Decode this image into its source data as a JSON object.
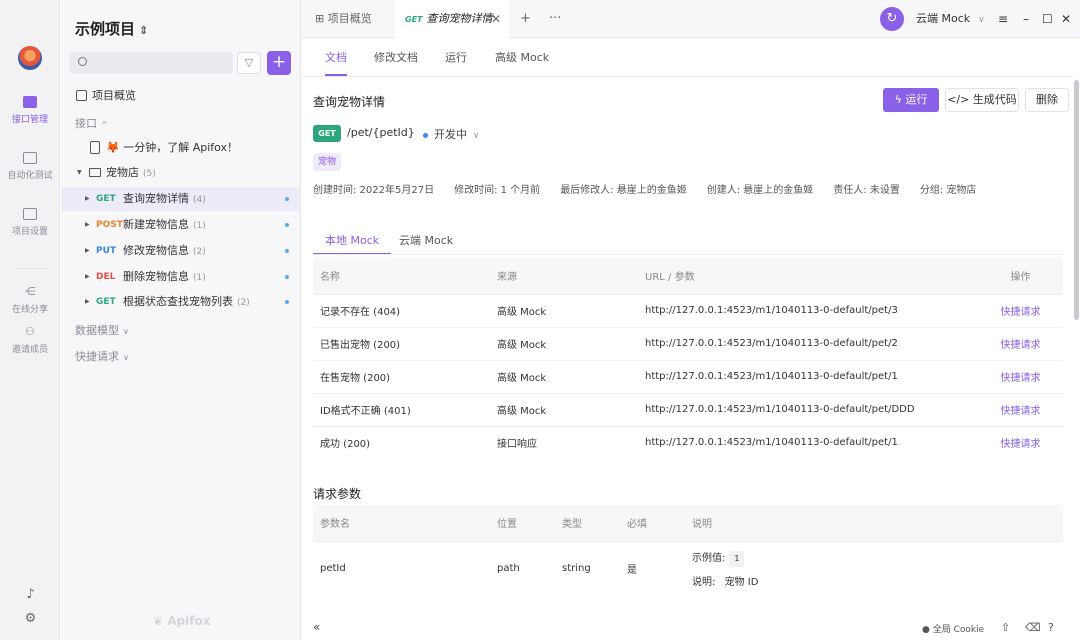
{
  "rail": {
    "items": [
      {
        "label": "接口管理"
      },
      {
        "label": "自动化测试"
      },
      {
        "label": "项目设置"
      },
      {
        "label": "在线分享"
      },
      {
        "label": "邀请成员"
      }
    ]
  },
  "sidebar": {
    "project_title": "示例项目",
    "overview": "项目概览",
    "api_section": "接口",
    "intro_item": "🦊 一分钟，了解 Apifox！",
    "folder": {
      "name": "宠物店",
      "count": "(5)"
    },
    "endpoints": [
      {
        "method": "GET",
        "name": "查询宠物详情",
        "count": "(4)"
      },
      {
        "method": "POST",
        "name": "新建宠物信息",
        "count": "(1)"
      },
      {
        "method": "PUT",
        "name": "修改宠物信息",
        "count": "(2)"
      },
      {
        "method": "DEL",
        "name": "删除宠物信息",
        "count": "(1)"
      },
      {
        "method": "GET",
        "name": "根据状态查找宠物列表",
        "count": "(2)"
      }
    ],
    "data_models": "数据模型",
    "quick_requests": "快捷请求",
    "brand": "Apifox"
  },
  "tabbar": {
    "tab_overview": "项目概览",
    "tab_active_method": "GET",
    "tab_active_label": "查询宠物详情",
    "env_label": "云端 Mock"
  },
  "content_tabs": [
    "文档",
    "修改文档",
    "运行",
    "高级 Mock"
  ],
  "doc": {
    "title": "查询宠物详情",
    "run_button": "运行",
    "gencode_button": "生成代码",
    "delete_button": "删除",
    "method": "GET",
    "path": "/pet/{petId}",
    "status": "开发中",
    "tag": "宠物",
    "meta": {
      "created": "创建时间: 2022年5月27日",
      "modified": "修改时间: 1 个月前",
      "last_editor": "最后修改人: 悬崖上的金鱼姬",
      "creator": "创建人: 悬崖上的金鱼姬",
      "owner": "责任人: 未设置",
      "group": "分组: 宠物店"
    }
  },
  "mock": {
    "tabs": [
      "本地 Mock",
      "云端 Mock"
    ],
    "headers": [
      "名称",
      "来源",
      "URL / 参数",
      "操作"
    ],
    "rows": [
      {
        "name": "记录不存在 (404)",
        "source": "高级 Mock",
        "url": "http://127.0.0.1:4523/m1/1040113-0-default/pet/3",
        "action": "快捷请求"
      },
      {
        "name": "已售出宠物 (200)",
        "source": "高级 Mock",
        "url": "http://127.0.0.1:4523/m1/1040113-0-default/pet/2",
        "action": "快捷请求"
      },
      {
        "name": "在售宠物 (200)",
        "source": "高级 Mock",
        "url": "http://127.0.0.1:4523/m1/1040113-0-default/pet/1",
        "action": "快捷请求"
      },
      {
        "name": "ID格式不正确 (401)",
        "source": "高级 Mock",
        "url": "http://127.0.0.1:4523/m1/1040113-0-default/pet/DDD",
        "action": "快捷请求"
      },
      {
        "name": "成功 (200)",
        "source": "接口响应",
        "url": "http://127.0.0.1:4523/m1/1040113-0-default/pet/1",
        "action": "快捷请求"
      }
    ]
  },
  "params": {
    "title": "请求参数",
    "headers": [
      "参数名",
      "位置",
      "类型",
      "必填",
      "说明"
    ],
    "row": {
      "name": "petId",
      "location": "path",
      "type": "string",
      "required": "是",
      "example_label": "示例值:",
      "example_value": "1",
      "desc_label": "说明:",
      "desc_value": "宠物 ID"
    }
  },
  "footer": {
    "cookie": "全局 Cookie"
  },
  "colors": {
    "accent": "#8a60e8",
    "get": "#2ea67b",
    "post": "#f0822d",
    "put": "#3c8ae6",
    "del": "#e14b4b"
  }
}
